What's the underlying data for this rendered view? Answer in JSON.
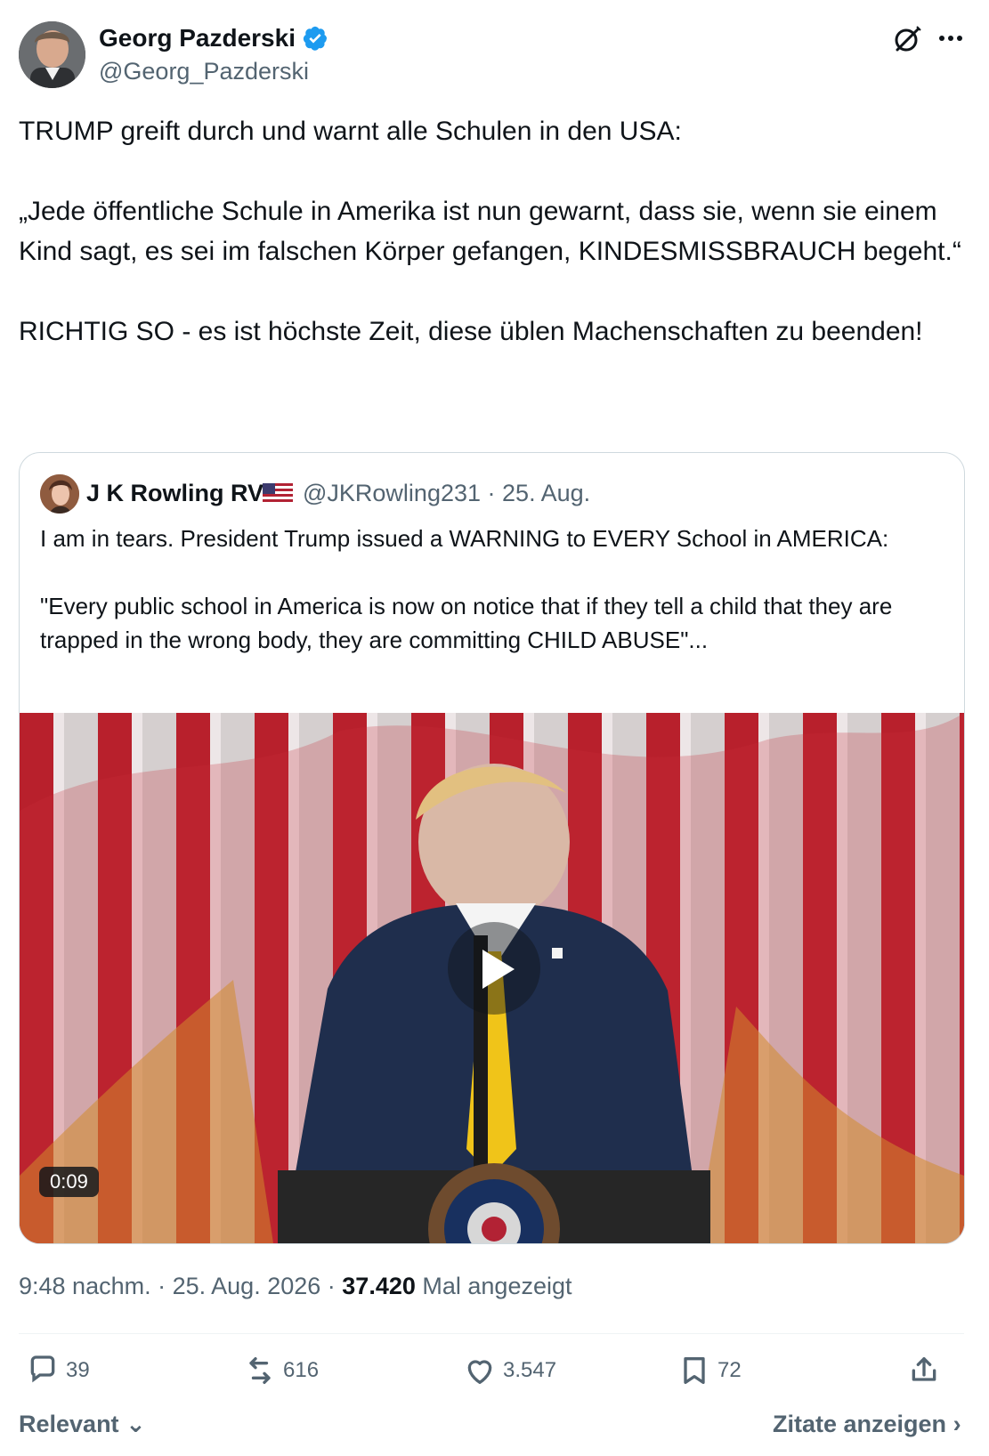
{
  "post": {
    "author_name": "Georg Pazderski",
    "author_handle": "@Georg_Pazderski",
    "text": "TRUMP greift durch und warnt alle Schulen in den USA:\n\n„Jede öffentliche Schule in Amerika ist nun gewarnt, dass sie, wenn sie einem Kind sagt, es sei im falschen Körper gefangen, KINDESMISSBRAUCH begeht.“\n\nRICHTIG SO - es ist höchste Zeit, diese üblen Machenschaften zu beenden!",
    "time": "9:48 nachm.",
    "date": "25. Aug. 2026",
    "views": "37.420",
    "views_label": "Mal angezeigt"
  },
  "quote": {
    "author_name": "J K Rowling RV",
    "author_handle": "@JKRowling231",
    "date": "25. Aug.",
    "text": "I am in tears. President Trump issued a WARNING to EVERY School in AMERICA:\n\n\"Every public school in America is now on notice that if they tell a child that they are trapped in the wrong body, they are committing CHILD ABUSE\"...",
    "video_duration": "0:09"
  },
  "actions": {
    "replies": "39",
    "reposts": "616",
    "likes": "3.547",
    "bookmarks": "72"
  },
  "footer": {
    "sort_label": "Relevant",
    "quotes_label": "Zitate anzeigen"
  },
  "icons": {
    "verified": "verified-badge-icon",
    "grok": "grok-icon",
    "more": "more-icon",
    "flag": "us-flag-icon",
    "reply": "reply-icon",
    "repost": "repost-icon",
    "like": "heart-icon",
    "bookmark": "bookmark-icon",
    "share": "share-icon"
  },
  "colors": {
    "verified": "#1d9bf0",
    "text": "#0f1419",
    "secondary": "#536471",
    "border": "#cfd9de"
  }
}
